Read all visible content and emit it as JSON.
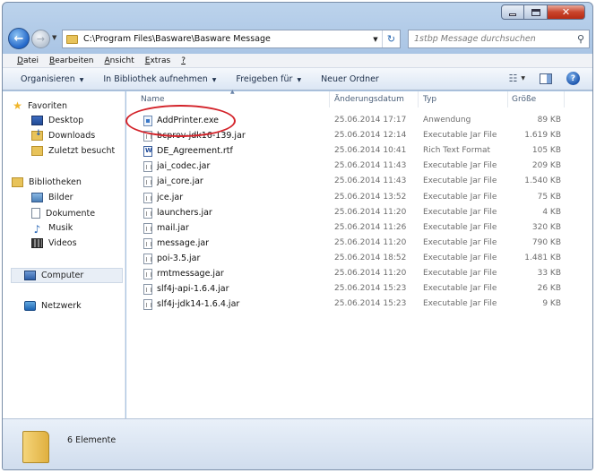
{
  "window": {
    "address_path": "C:\\Program Files\\Basware\\Basware Message",
    "search_placeholder": "1stbp Message durchsuchen"
  },
  "menubar": {
    "items": [
      {
        "label": "Datei",
        "accel": "D"
      },
      {
        "label": "Bearbeiten",
        "accel": "B"
      },
      {
        "label": "Ansicht",
        "accel": "A"
      },
      {
        "label": "Extras",
        "accel": "E"
      },
      {
        "label": "?"
      }
    ]
  },
  "toolbar": {
    "organize": "Organisieren",
    "library": "In Bibliothek aufnehmen",
    "share": "Freigeben für",
    "new_folder": "Neuer Ordner"
  },
  "navigation": {
    "favorites_header": "Favoriten",
    "favorites": [
      "Desktop",
      "Downloads",
      "Zuletzt besucht"
    ],
    "libraries_header": "Bibliotheken",
    "libraries": [
      "Bilder",
      "Dokumente",
      "Musik",
      "Videos"
    ],
    "computer": "Computer",
    "network": "Netzwerk"
  },
  "columns": {
    "name": "Name",
    "date": "Änderungsdatum",
    "type": "Typ",
    "size": "Größe"
  },
  "files": [
    {
      "name": "AddPrinter.exe",
      "date": "25.06.2014 17:17",
      "type": "Anwendung",
      "size": "89 KB",
      "icon": "exe-icon"
    },
    {
      "name": "bcprov-jdk16-139.jar",
      "date": "25.06.2014 12:14",
      "type": "Executable Jar File",
      "size": "1.619 KB",
      "icon": "jar-icon"
    },
    {
      "name": "DE_Agreement.rtf",
      "date": "25.06.2014 10:41",
      "type": "Rich Text Format",
      "size": "105 KB",
      "icon": "rtf-icon"
    },
    {
      "name": "jai_codec.jar",
      "date": "25.06.2014 11:43",
      "type": "Executable Jar File",
      "size": "209 KB",
      "icon": "jar-icon"
    },
    {
      "name": "jai_core.jar",
      "date": "25.06.2014 11:43",
      "type": "Executable Jar File",
      "size": "1.540 KB",
      "icon": "jar-icon"
    },
    {
      "name": "jce.jar",
      "date": "25.06.2014 13:52",
      "type": "Executable Jar File",
      "size": "75 KB",
      "icon": "jar-icon"
    },
    {
      "name": "launchers.jar",
      "date": "25.06.2014 11:20",
      "type": "Executable Jar File",
      "size": "4 KB",
      "icon": "jar-icon"
    },
    {
      "name": "mail.jar",
      "date": "25.06.2014 11:26",
      "type": "Executable Jar File",
      "size": "320 KB",
      "icon": "jar-icon"
    },
    {
      "name": "message.jar",
      "date": "25.06.2014 11:20",
      "type": "Executable Jar File",
      "size": "790 KB",
      "icon": "jar-icon"
    },
    {
      "name": "poi-3.5.jar",
      "date": "25.06.2014 18:52",
      "type": "Executable Jar File",
      "size": "1.481 KB",
      "icon": "jar-icon"
    },
    {
      "name": "rmtmessage.jar",
      "date": "25.06.2014 11:20",
      "type": "Executable Jar File",
      "size": "33 KB",
      "icon": "jar-icon"
    },
    {
      "name": "slf4j-api-1.6.4.jar",
      "date": "25.06.2014 15:23",
      "type": "Executable Jar File",
      "size": "26 KB",
      "icon": "jar-icon"
    },
    {
      "name": "slf4j-jdk14-1.6.4.jar",
      "date": "25.06.2014 15:23",
      "type": "Executable Jar File",
      "size": "9 KB",
      "icon": "jar-icon"
    }
  ],
  "status": {
    "item_count": "6 Elemente"
  },
  "colors": {
    "highlight_circle": "#d3232a",
    "close_button": "#c9452c"
  }
}
